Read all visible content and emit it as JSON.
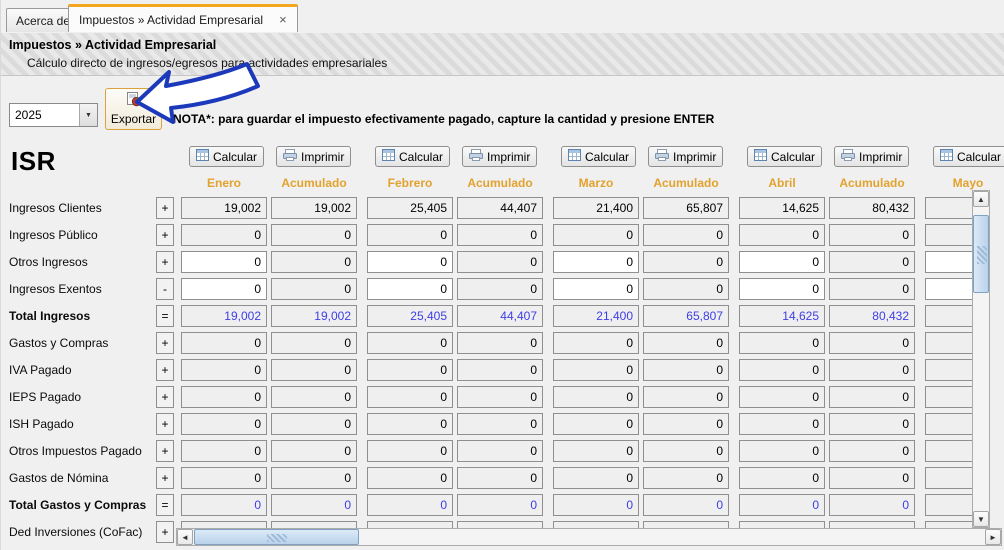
{
  "tabs": [
    {
      "label": "Acerca de"
    },
    {
      "label": "Impuestos » Actividad Empresarial",
      "close_glyph": "×"
    }
  ],
  "header": {
    "title": "Impuestos » Actividad Empresarial",
    "subtitle": "Cálculo directo de ingresos/egresos para actividades empresariales"
  },
  "toolbar": {
    "year": "2025",
    "export_label": "Exportar",
    "note": "NOTA*: para guardar el impuesto efectivamente pagado, capture la cantidad y presione ENTER"
  },
  "section_title": "ISR",
  "column_buttons": {
    "calcular": "Calcular",
    "imprimir": "Imprimir"
  },
  "months": [
    "Enero",
    "Febrero",
    "Marzo",
    "Abril",
    "Mayo"
  ],
  "accum_label": "Acumulado",
  "rows": [
    {
      "label": "Ingresos Clientes",
      "op": "+",
      "bold": false,
      "total": false,
      "editable": false,
      "values": [
        [
          "19,002",
          "19,002"
        ],
        [
          "25,405",
          "44,407"
        ],
        [
          "21,400",
          "65,807"
        ],
        [
          "14,625",
          "80,432"
        ],
        [
          "",
          ""
        ]
      ]
    },
    {
      "label": "Ingresos Público",
      "op": "+",
      "bold": false,
      "total": false,
      "editable": false,
      "values": [
        [
          "0",
          "0"
        ],
        [
          "0",
          "0"
        ],
        [
          "0",
          "0"
        ],
        [
          "0",
          "0"
        ],
        [
          "",
          ""
        ]
      ]
    },
    {
      "label": "Otros Ingresos",
      "op": "+",
      "bold": false,
      "total": false,
      "editable": true,
      "values": [
        [
          "0",
          "0"
        ],
        [
          "0",
          "0"
        ],
        [
          "0",
          "0"
        ],
        [
          "0",
          "0"
        ],
        [
          "",
          ""
        ]
      ]
    },
    {
      "label": "Ingresos Exentos",
      "op": "-",
      "bold": false,
      "total": false,
      "editable": true,
      "values": [
        [
          "0",
          "0"
        ],
        [
          "0",
          "0"
        ],
        [
          "0",
          "0"
        ],
        [
          "0",
          "0"
        ],
        [
          "",
          ""
        ]
      ]
    },
    {
      "label": "Total Ingresos",
      "op": "=",
      "bold": true,
      "total": true,
      "editable": false,
      "values": [
        [
          "19,002",
          "19,002"
        ],
        [
          "25,405",
          "44,407"
        ],
        [
          "21,400",
          "65,807"
        ],
        [
          "14,625",
          "80,432"
        ],
        [
          "",
          ""
        ]
      ]
    },
    {
      "label": "Gastos y Compras",
      "op": "+",
      "bold": false,
      "total": false,
      "editable": false,
      "values": [
        [
          "0",
          "0"
        ],
        [
          "0",
          "0"
        ],
        [
          "0",
          "0"
        ],
        [
          "0",
          "0"
        ],
        [
          "",
          ""
        ]
      ]
    },
    {
      "label": "IVA Pagado",
      "op": "+",
      "bold": false,
      "total": false,
      "editable": false,
      "values": [
        [
          "0",
          "0"
        ],
        [
          "0",
          "0"
        ],
        [
          "0",
          "0"
        ],
        [
          "0",
          "0"
        ],
        [
          "",
          ""
        ]
      ]
    },
    {
      "label": "IEPS Pagado",
      "op": "+",
      "bold": false,
      "total": false,
      "editable": false,
      "values": [
        [
          "0",
          "0"
        ],
        [
          "0",
          "0"
        ],
        [
          "0",
          "0"
        ],
        [
          "0",
          "0"
        ],
        [
          "",
          ""
        ]
      ]
    },
    {
      "label": "ISH Pagado",
      "op": "+",
      "bold": false,
      "total": false,
      "editable": false,
      "values": [
        [
          "0",
          "0"
        ],
        [
          "0",
          "0"
        ],
        [
          "0",
          "0"
        ],
        [
          "0",
          "0"
        ],
        [
          "",
          ""
        ]
      ]
    },
    {
      "label": "Otros Impuestos Pagado",
      "op": "+",
      "bold": false,
      "total": false,
      "editable": false,
      "values": [
        [
          "0",
          "0"
        ],
        [
          "0",
          "0"
        ],
        [
          "0",
          "0"
        ],
        [
          "0",
          "0"
        ],
        [
          "",
          ""
        ]
      ]
    },
    {
      "label": "Gastos de Nómina",
      "op": "+",
      "bold": false,
      "total": false,
      "editable": false,
      "values": [
        [
          "0",
          "0"
        ],
        [
          "0",
          "0"
        ],
        [
          "0",
          "0"
        ],
        [
          "0",
          "0"
        ],
        [
          "",
          ""
        ]
      ]
    },
    {
      "label": "Total Gastos y Compras",
      "op": "=",
      "bold": true,
      "total": true,
      "editable": false,
      "values": [
        [
          "0",
          "0"
        ],
        [
          "0",
          "0"
        ],
        [
          "0",
          "0"
        ],
        [
          "0",
          "0"
        ],
        [
          "",
          ""
        ]
      ]
    },
    {
      "label": "Ded Inversiones (CoFac)",
      "op": "+",
      "bold": false,
      "total": false,
      "editable": false,
      "values": [
        [
          "",
          ""
        ],
        [
          "",
          ""
        ],
        [
          "",
          ""
        ],
        [
          "",
          ""
        ],
        [
          "",
          ""
        ]
      ]
    }
  ],
  "scrollbars": {
    "up": "▲",
    "down": "▼",
    "left": "◄",
    "right": "►"
  },
  "combo_arrow": "▼",
  "colors": {
    "tab_highlight": "#F2A71E",
    "month_label": "#E2A22E",
    "total_value": "#3E3EE6"
  }
}
